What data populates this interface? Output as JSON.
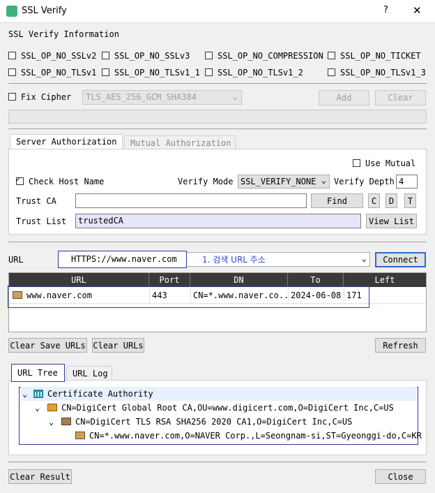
{
  "window": {
    "title": "SSL Verify",
    "help": "?",
    "close": "✕"
  },
  "info_title": "SSL Verify Information",
  "options": [
    "SSL_OP_NO_SSLv2",
    "SSL_OP_NO_SSLv3",
    "SSL_OP_NO_COMPRESSION",
    "SSL_OP_NO_TICKET",
    "SSL_OP_NO_TLSv1",
    "SSL_OP_NO_TLSv1_1",
    "SSL_OP_NO_TLSv1_2",
    "SSL_OP_NO_TLSv1_3"
  ],
  "cipher": {
    "label": "Fix Cipher",
    "value": "TLS_AES_256_GCM_SHA384",
    "add": "Add",
    "clear": "Clear"
  },
  "tabs": {
    "server": "Server Authorization",
    "mutual": "Mutual Authorization"
  },
  "server": {
    "use_mutual": "Use Mutual",
    "check_host": "Check Host Name",
    "verify_mode_label": "Verify Mode",
    "verify_mode": "SSL_VERIFY_NONE",
    "verify_depth_label": "Verify Depth",
    "verify_depth": "4",
    "trust_ca_label": "Trust CA",
    "trust_ca_value": "",
    "find": "Find",
    "c": "C",
    "d": "D",
    "t": "T",
    "trust_list_label": "Trust List",
    "trust_list_value": "trustedCA",
    "view_list": "View List"
  },
  "url": {
    "label": "URL",
    "value": "HTTPS://www.naver.com",
    "annotation": "1. 검색 URL 주소",
    "connect": "Connect"
  },
  "table": {
    "headers": [
      "URL",
      "Port",
      "DN",
      "To",
      "Left"
    ],
    "rows": [
      {
        "url": "www.naver.com",
        "port": "443",
        "dn": "CN=*.www.naver.co...",
        "to": "2024-06-08",
        "left": "171"
      }
    ]
  },
  "buttons": {
    "clear_save": "Clear Save URLs",
    "clear_urls": "Clear URLs",
    "refresh": "Refresh",
    "clear_result": "Clear Result",
    "close": "Close"
  },
  "bottom_tabs": {
    "tree": "URL Tree",
    "log": "URL Log"
  },
  "tree": [
    "Certificate Authority",
    "CN=DigiCert Global Root CA,OU=www.digicert.com,O=DigiCert Inc,C=US",
    "CN=DigiCert TLS RSA SHA256 2020 CA1,O=DigiCert Inc,C=US",
    "CN=*.www.naver.com,O=NAVER Corp.,L=Seongnam-si,ST=Gyeonggi-do,C=KR"
  ],
  "colors": {
    "accent_blue": "#2a3aa0",
    "header_dark": "#3a3a3a",
    "trust_list_bg": "#e6e6fa"
  }
}
